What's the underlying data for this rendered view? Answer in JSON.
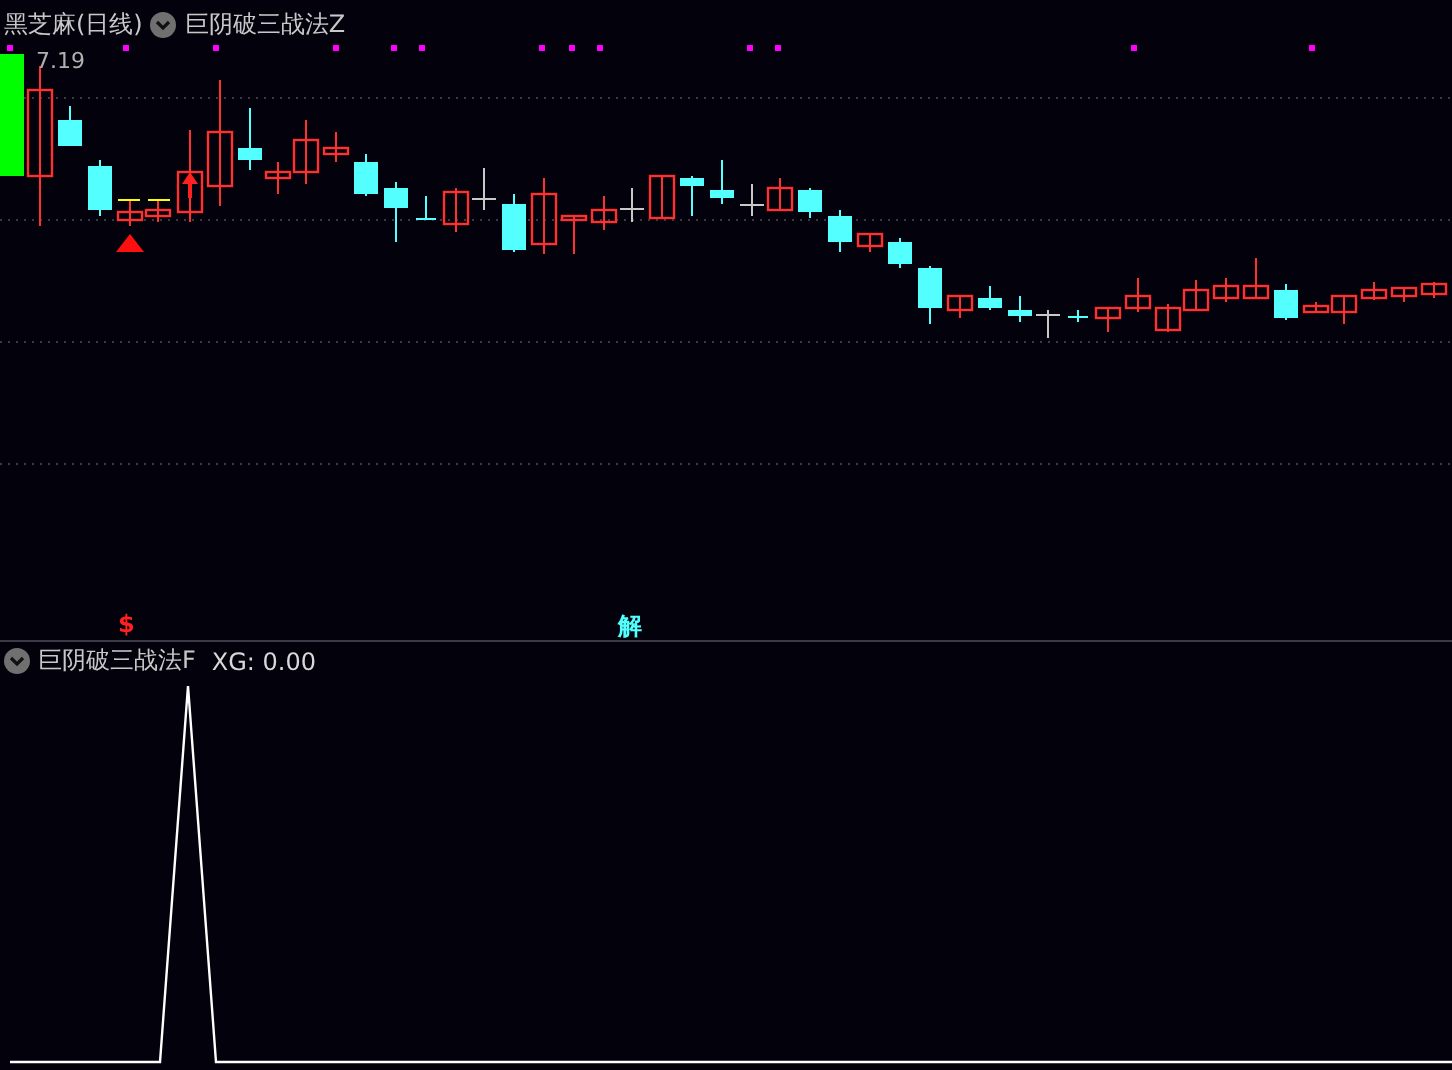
{
  "main_panel": {
    "title": "黑芝麻(日线)",
    "indicator": "巨阴破三战法Z",
    "price_label": "7.19",
    "markers": [
      {
        "kind": "buy",
        "text": "$"
      },
      {
        "kind": "unlock",
        "text": "解"
      }
    ]
  },
  "sub_panel": {
    "indicator": "巨阴破三战法F",
    "reading": "XG: 0.00"
  }
}
